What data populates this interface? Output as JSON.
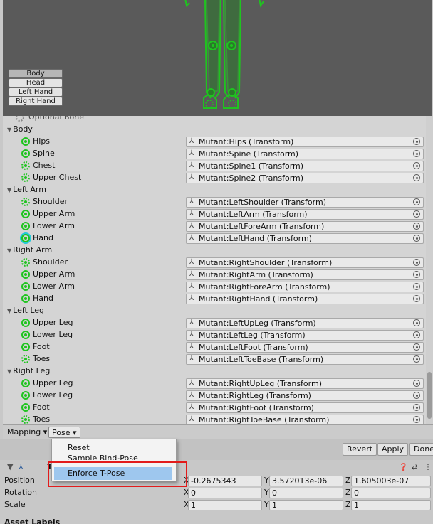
{
  "preview": {
    "buttons": [
      {
        "label": "Body",
        "active": true
      },
      {
        "label": "Head",
        "active": false
      },
      {
        "label": "Left Hand",
        "active": false
      },
      {
        "label": "Right Hand",
        "active": false
      }
    ]
  },
  "bones": {
    "optional_legend": "Optional Bone",
    "groups": [
      {
        "name": "Body",
        "items": [
          {
            "label": "Hips",
            "value": "Mutant:Hips (Transform)",
            "optional": false
          },
          {
            "label": "Spine",
            "value": "Mutant:Spine (Transform)",
            "optional": false
          },
          {
            "label": "Chest",
            "value": "Mutant:Spine1 (Transform)",
            "optional": true
          },
          {
            "label": "Upper Chest",
            "value": "Mutant:Spine2 (Transform)",
            "optional": true
          }
        ]
      },
      {
        "name": "Left Arm",
        "items": [
          {
            "label": "Shoulder",
            "value": "Mutant:LeftShoulder (Transform)",
            "optional": true
          },
          {
            "label": "Upper Arm",
            "value": "Mutant:LeftArm (Transform)",
            "optional": false
          },
          {
            "label": "Lower Arm",
            "value": "Mutant:LeftForeArm (Transform)",
            "optional": false
          },
          {
            "label": "Hand",
            "value": "Mutant:LeftHand (Transform)",
            "optional": false,
            "selected": true
          }
        ]
      },
      {
        "name": "Right Arm",
        "items": [
          {
            "label": "Shoulder",
            "value": "Mutant:RightShoulder (Transform)",
            "optional": true
          },
          {
            "label": "Upper Arm",
            "value": "Mutant:RightArm (Transform)",
            "optional": false
          },
          {
            "label": "Lower Arm",
            "value": "Mutant:RightForeArm (Transform)",
            "optional": false
          },
          {
            "label": "Hand",
            "value": "Mutant:RightHand (Transform)",
            "optional": false
          }
        ]
      },
      {
        "name": "Left Leg",
        "items": [
          {
            "label": "Upper Leg",
            "value": "Mutant:LeftUpLeg (Transform)",
            "optional": false
          },
          {
            "label": "Lower Leg",
            "value": "Mutant:LeftLeg (Transform)",
            "optional": false
          },
          {
            "label": "Foot",
            "value": "Mutant:LeftFoot (Transform)",
            "optional": false
          },
          {
            "label": "Toes",
            "value": "Mutant:LeftToeBase (Transform)",
            "optional": true
          }
        ]
      },
      {
        "name": "Right Leg",
        "items": [
          {
            "label": "Upper Leg",
            "value": "Mutant:RightUpLeg (Transform)",
            "optional": false
          },
          {
            "label": "Lower Leg",
            "value": "Mutant:RightLeg (Transform)",
            "optional": false
          },
          {
            "label": "Foot",
            "value": "Mutant:RightFoot (Transform)",
            "optional": false
          },
          {
            "label": "Toes",
            "value": "Mutant:RightToeBase (Transform)",
            "optional": true
          }
        ]
      }
    ]
  },
  "toolbar": {
    "mapping_label": "Mapping ▾",
    "pose_label": "Pose ▾"
  },
  "pose_menu": {
    "items": [
      "Reset",
      "Sample Bind-Pose",
      "Enforce T-Pose"
    ],
    "highlighted": "Enforce T-Pose"
  },
  "actions": {
    "revert": "Revert",
    "apply": "Apply",
    "done": "Done"
  },
  "transform": {
    "header_initial": "T",
    "rows": [
      {
        "label": "Position",
        "x": "-0.2675343",
        "y": "3.572013e-06",
        "z": "1.605003e-07"
      },
      {
        "label": "Rotation",
        "x": "0",
        "y": "0",
        "z": "0"
      },
      {
        "label": "Scale",
        "x": "1",
        "y": "1",
        "z": "1"
      }
    ],
    "axis_labels": {
      "x": "X",
      "y": "Y",
      "z": "Z"
    }
  },
  "footer": {
    "asset_labels": "Asset Labels"
  },
  "colors": {
    "bone_green": "#1fc41f",
    "menu_highlight": "#9ec7ee",
    "callout_red": "#e21b1b"
  }
}
